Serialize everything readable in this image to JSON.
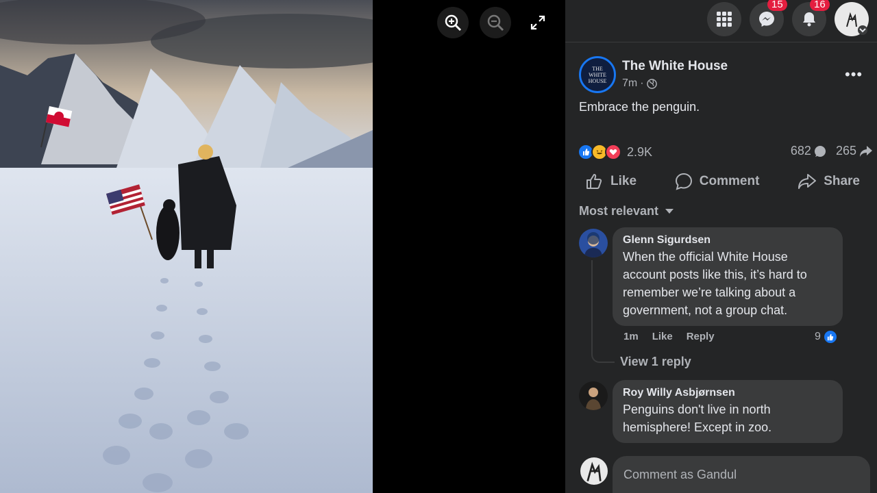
{
  "viewer": {
    "zoom_in_icon": "zoom-in-icon",
    "zoom_out_icon": "zoom-out-icon",
    "fullscreen_icon": "fullscreen-icon"
  },
  "topbar": {
    "menu_icon": "grid-menu-icon",
    "messenger_badge": "15",
    "notifications_badge": "16"
  },
  "post": {
    "page_name": "The White House",
    "avatar_text": "THE WHITE HOUSE",
    "time": "7m",
    "audience_icon": "globe-icon",
    "text": "Embrace the penguin.",
    "reaction_count": "2.9K",
    "comment_count": "682",
    "share_count": "265"
  },
  "actions": {
    "like": "Like",
    "comment": "Comment",
    "share": "Share"
  },
  "comments_sort": "Most relevant",
  "comments": [
    {
      "author": "Glenn Sigurdsen",
      "text": "When the official White House account posts like this, it’s hard to remember we’re talking about a government, not a group chat.",
      "time": "1m",
      "like": "Like",
      "reply": "Reply",
      "likes": "9",
      "view_replies": "View 1 reply"
    },
    {
      "author": "Roy Willy Asbjørnsen",
      "text": "Penguins don't live in north hemisphere! Except in zoo."
    }
  ],
  "composer": {
    "placeholder": "Comment as Gandul"
  },
  "colors": {
    "panel_bg": "#242526",
    "bubble_bg": "#3a3b3c",
    "accent": "#1877f2",
    "badge": "#e41e3f"
  }
}
